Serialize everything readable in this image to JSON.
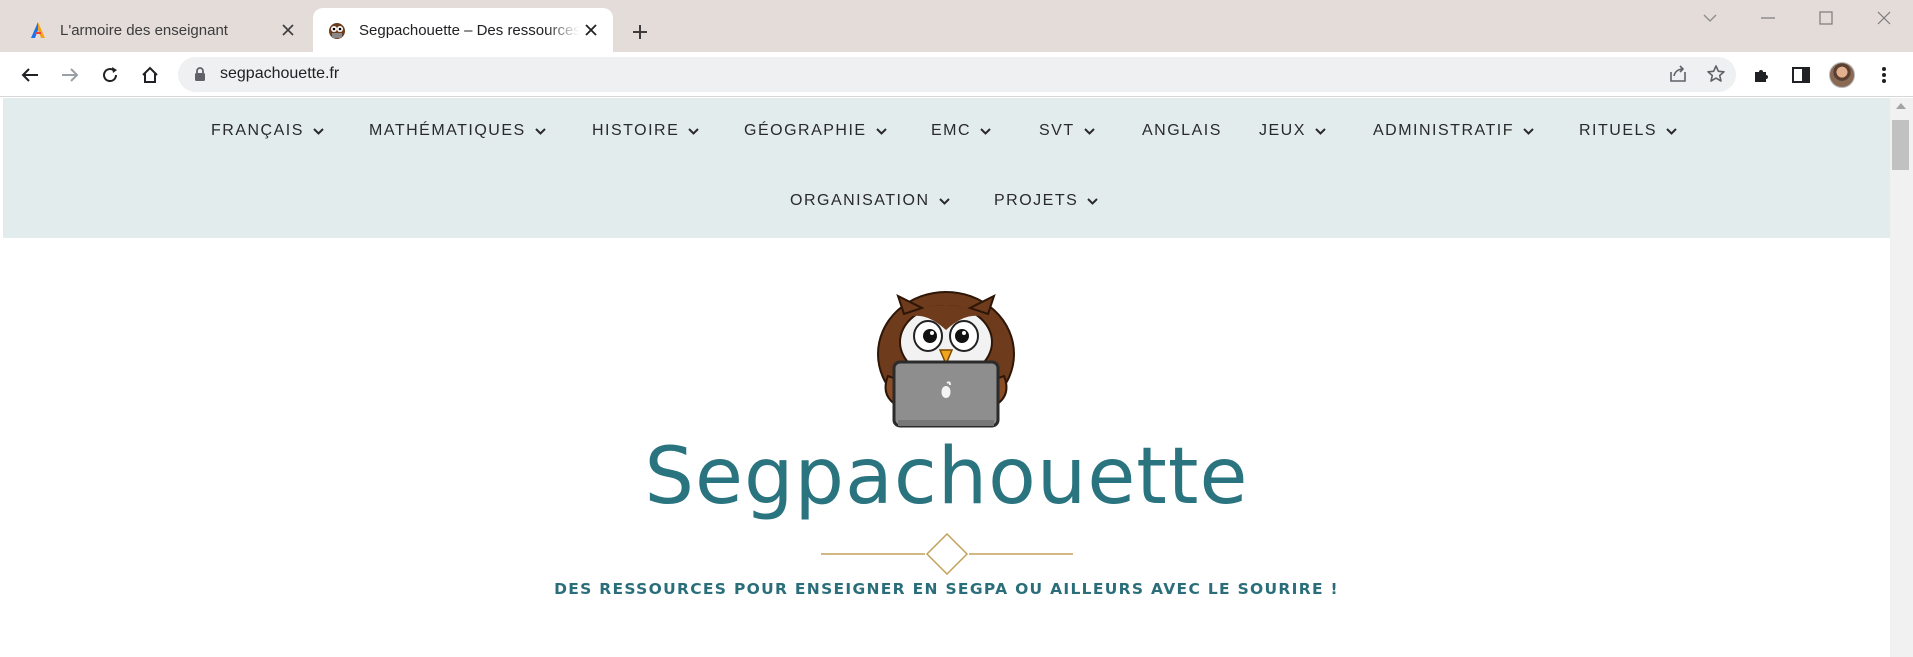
{
  "browser": {
    "tabs": [
      {
        "title": "L'armoire des enseignant",
        "favicon": "letter-a-icon"
      },
      {
        "title": "Segpachouette – Des ressources pour enseigner",
        "favicon": "owl-icon"
      }
    ],
    "url": "segpachouette.fr"
  },
  "site": {
    "nav_row1": [
      "FRANÇAIS",
      "MATHÉMATIQUES",
      "HISTOIRE",
      "GÉOGRAPHIE",
      "EMC",
      "SVT",
      "ANGLAIS",
      "JEUX",
      "ADMINISTRATIF",
      "RITUELS"
    ],
    "nav_row2": [
      "ORGANISATION",
      "PROJETS"
    ],
    "title": "Segpachouette",
    "tagline": "DES RESSOURCES POUR ENSEIGNER EN SEGPA OU AILLEURS AVEC LE SOURIRE !"
  },
  "colors": {
    "nav_background": "#e2eced",
    "brand_teal": "#2a7480",
    "gold": "#c2a15a"
  }
}
